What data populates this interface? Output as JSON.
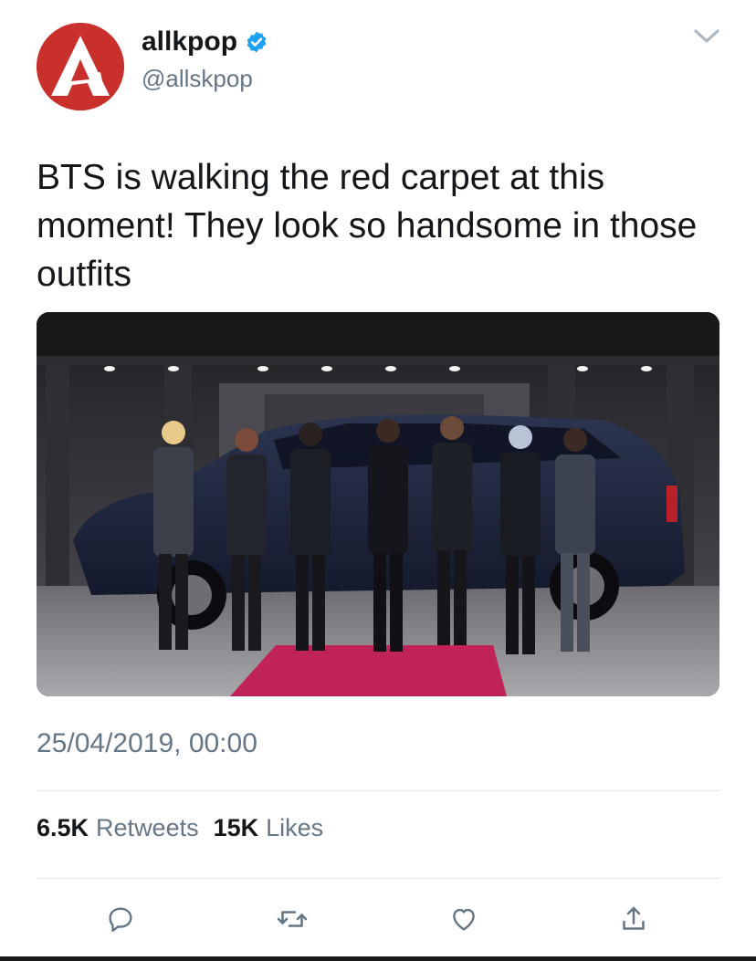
{
  "author": {
    "display_name": "allkpop",
    "handle": "@allskpop",
    "verified": true,
    "avatar_icon": "allkpop-logo-icon",
    "avatar_color": "#c9302c"
  },
  "tweet": {
    "text": "BTS is walking the red carpet at this moment! They look so handsome in those outfits",
    "timestamp": "25/04/2019, 00:00"
  },
  "stats": {
    "retweets_count": "6.5K",
    "retweets_label": "Retweets",
    "likes_count": "15K",
    "likes_label": "Likes"
  },
  "actions": [
    {
      "icon": "reply-icon"
    },
    {
      "icon": "retweet-icon"
    },
    {
      "icon": "like-icon"
    },
    {
      "icon": "share-icon"
    }
  ],
  "colors": {
    "text_primary": "#14171a",
    "text_secondary": "#657786",
    "verified_blue": "#1da1f2",
    "divider": "#e1e8ed",
    "carpet": "#c0235a"
  }
}
